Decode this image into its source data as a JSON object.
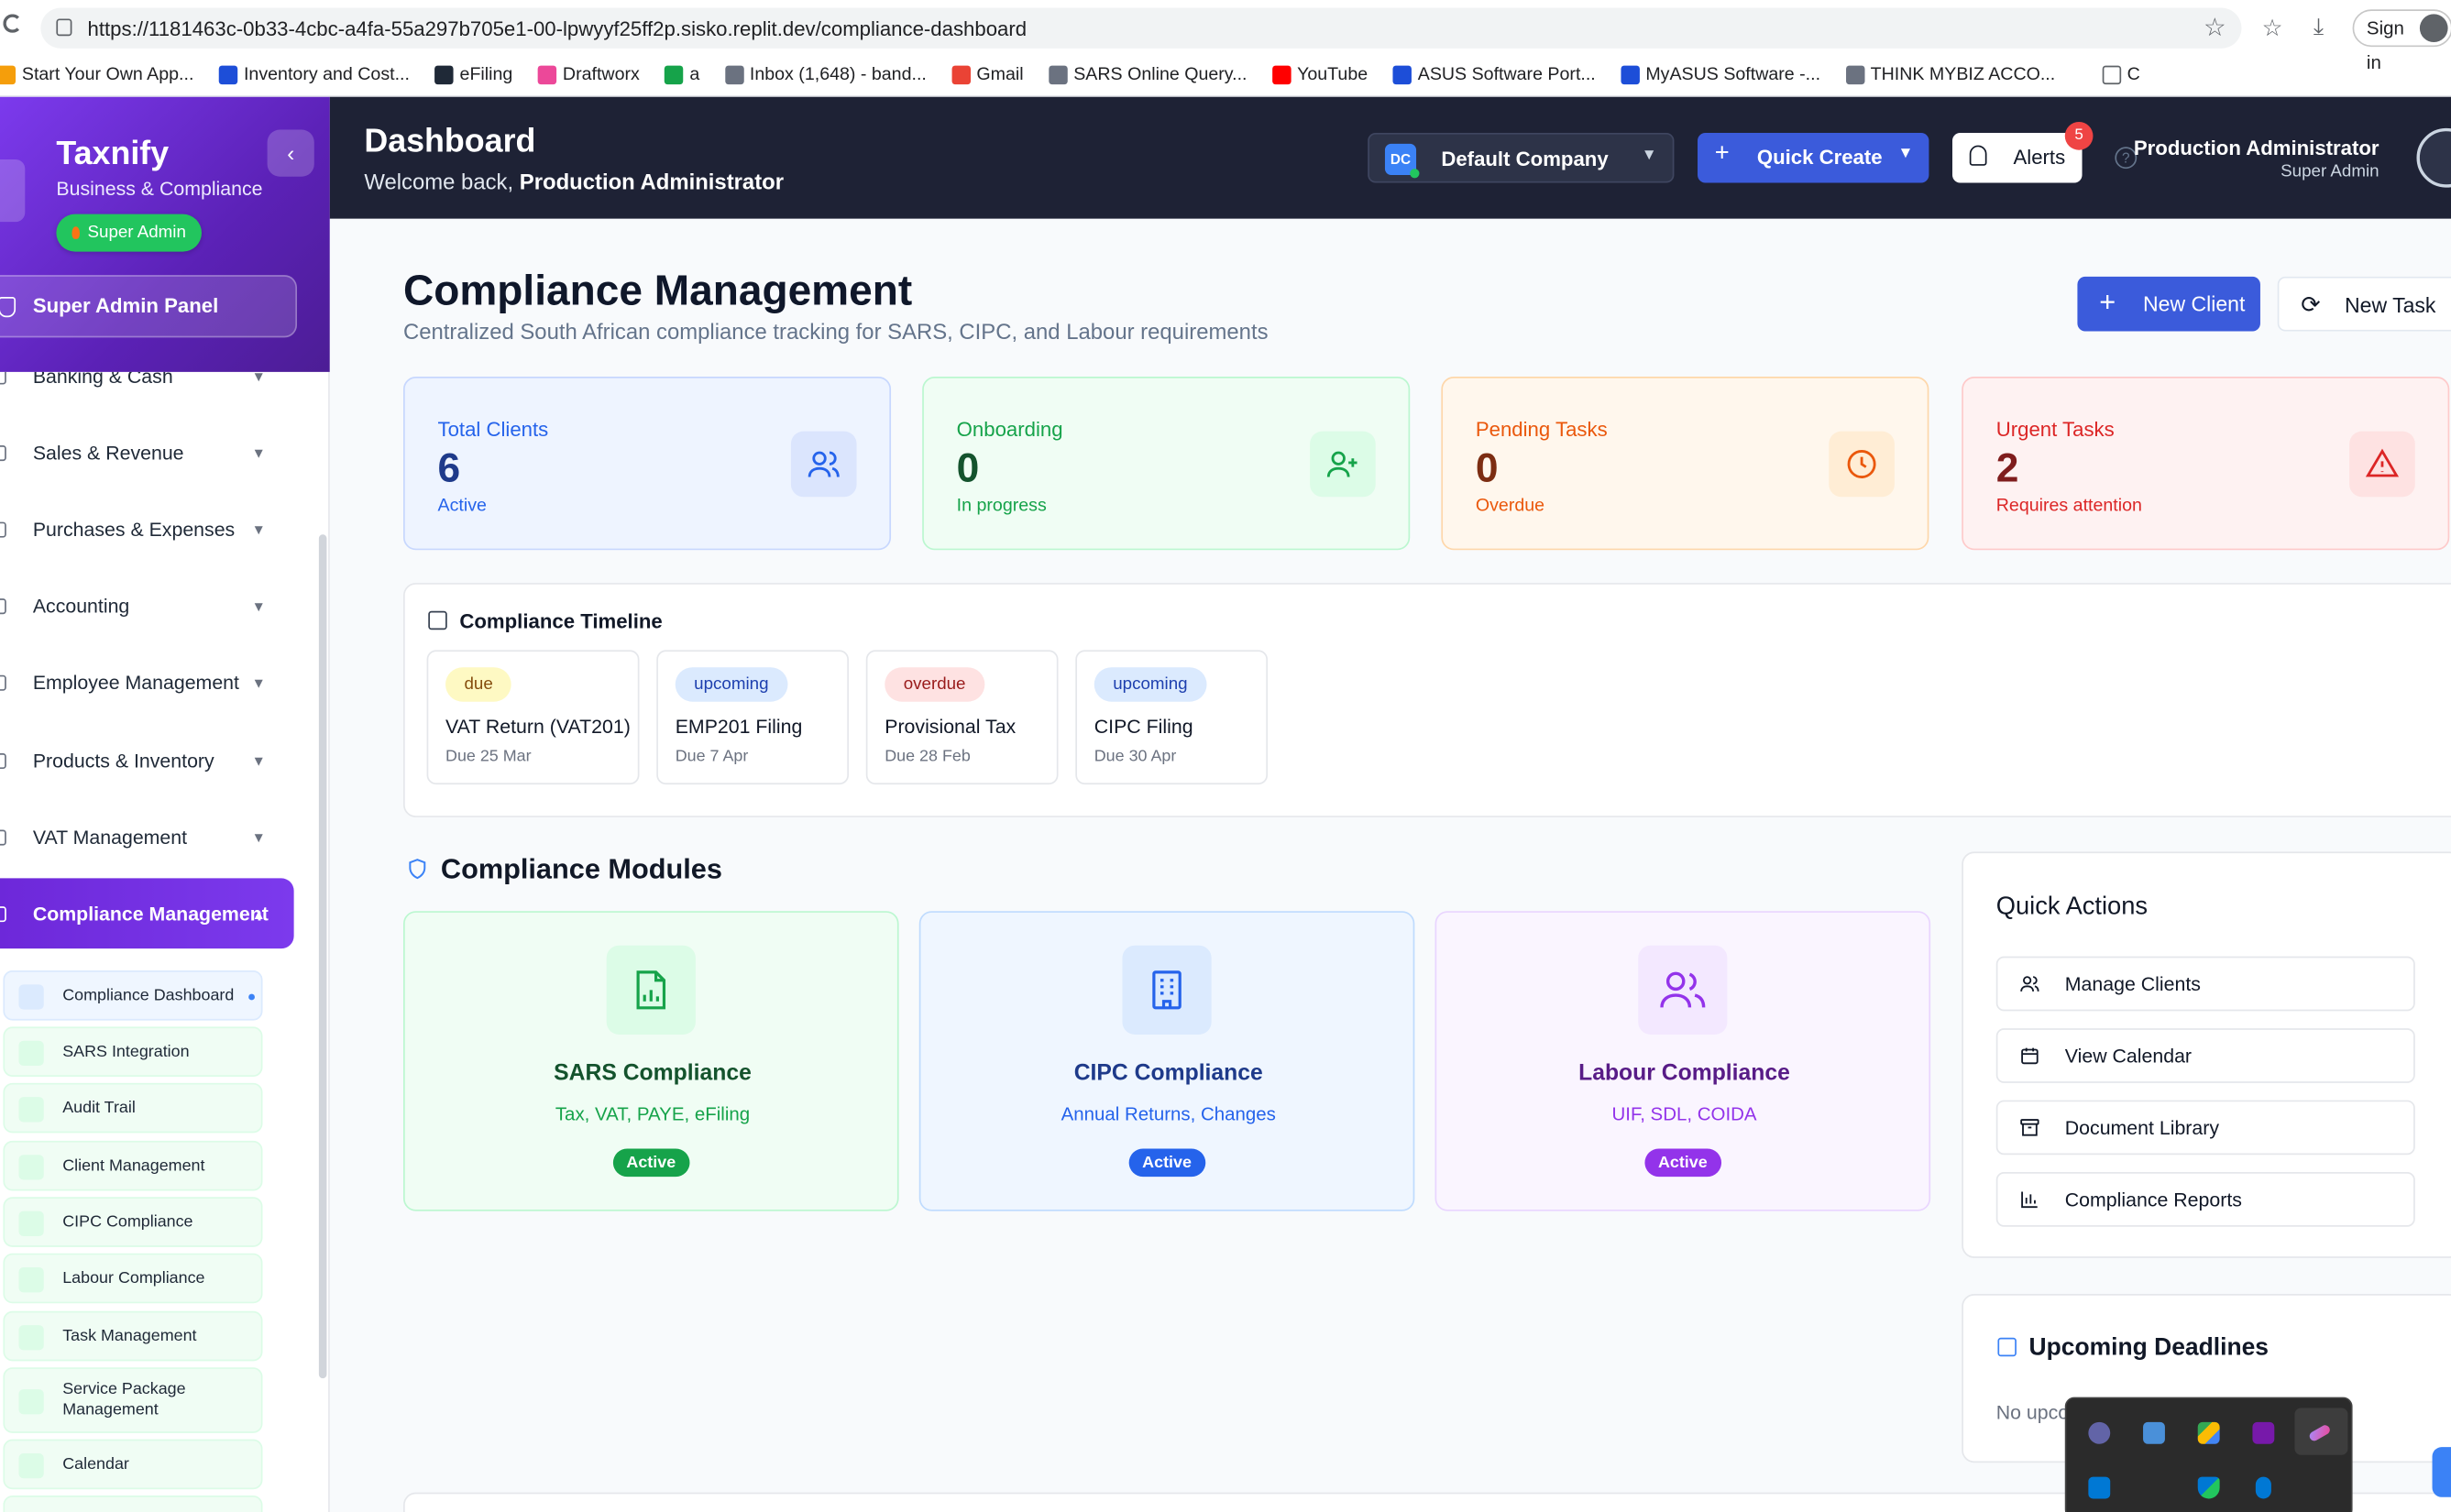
{
  "browser": {
    "url": "https://1181463c-0b33-4cbc-a4fa-55a297b705e1-00-lpwyyf25ff2p.sisko.replit.dev/compliance-dashboard",
    "signin_label": "Sign in",
    "bookmarks": [
      {
        "label": "Start Your Own App...",
        "color": "#f59e0b"
      },
      {
        "label": "Inventory and Cost...",
        "color": "#1d4ed8"
      },
      {
        "label": "eFiling",
        "color": "#1f2937"
      },
      {
        "label": "Draftworx",
        "color": "#ec4899"
      },
      {
        "label": "a",
        "color": "#16a34a"
      },
      {
        "label": "Inbox (1,648) - band...",
        "color": "#6b7280"
      },
      {
        "label": "Gmail",
        "color": "#ea4335"
      },
      {
        "label": "SARS Online Query...",
        "color": "#6b7280"
      },
      {
        "label": "YouTube",
        "color": "#ff0000"
      },
      {
        "label": "ASUS Software Port...",
        "color": "#1d4ed8"
      },
      {
        "label": "MyASUS Software -...",
        "color": "#1d4ed8"
      },
      {
        "label": "THINK MYBIZ ACCO...",
        "color": "#6b7280"
      }
    ],
    "bookmarks_overflow": "C"
  },
  "sidebar": {
    "brand": "Taxnify",
    "brand_sub": "Business & Compliance",
    "role_badge": "Super Admin",
    "collapse_icon": "chevron-left-icon",
    "super_admin_panel": "Super Admin Panel",
    "nav": [
      {
        "label": "Banking & Cash"
      },
      {
        "label": "Sales & Revenue"
      },
      {
        "label": "Purchases & Expenses"
      },
      {
        "label": "Accounting"
      },
      {
        "label": "Employee Management"
      },
      {
        "label": "Products & Inventory"
      },
      {
        "label": "VAT Management"
      },
      {
        "label": "Compliance Management"
      }
    ],
    "sub_items": [
      {
        "label": "Compliance Dashboard"
      },
      {
        "label": "SARS Integration"
      },
      {
        "label": "Audit Trail"
      },
      {
        "label": "Client Management"
      },
      {
        "label": "CIPC Compliance"
      },
      {
        "label": "Labour Compliance"
      },
      {
        "label": "Task Management"
      },
      {
        "label": "Service Package Management"
      },
      {
        "label": "Calendar"
      }
    ]
  },
  "header": {
    "title": "Dashboard",
    "welcome_prefix": "Welcome back,",
    "welcome_name": "Production Administrator",
    "company_initials": "DC",
    "company_name": "Default Company",
    "quick_create": "Quick Create",
    "alerts_label": "Alerts",
    "alerts_count": "5",
    "user_name": "Production Administrator",
    "user_role": "Super Admin"
  },
  "page": {
    "title": "Compliance Management",
    "subtitle": "Centralized South African compliance tracking for SARS, CIPC, and Labour requirements",
    "new_client": "New Client",
    "new_task": "New Task"
  },
  "stats": [
    {
      "title": "Total Clients",
      "value": "6",
      "sub": "Active",
      "icon": "users-icon"
    },
    {
      "title": "Onboarding",
      "value": "0",
      "sub": "In progress",
      "icon": "user-plus-icon"
    },
    {
      "title": "Pending Tasks",
      "value": "0",
      "sub": "Overdue",
      "icon": "clock-icon"
    },
    {
      "title": "Urgent Tasks",
      "value": "2",
      "sub": "Requires attention",
      "icon": "alert-triangle-icon"
    }
  ],
  "timeline": {
    "title": "Compliance Timeline",
    "items": [
      {
        "status": "due",
        "name": "VAT Return (VAT201)",
        "due": "Due 25 Mar"
      },
      {
        "status": "upcoming",
        "name": "EMP201 Filing",
        "due": "Due 7 Apr"
      },
      {
        "status": "overdue",
        "name": "Provisional Tax",
        "due": "Due 28 Feb"
      },
      {
        "status": "upcoming",
        "name": "CIPC Filing",
        "due": "Due 30 Apr"
      }
    ]
  },
  "modules": {
    "title": "Compliance Modules",
    "items": [
      {
        "name": "SARS Compliance",
        "desc": "Tax, VAT, PAYE, eFiling",
        "status": "Active",
        "icon": "file-chart-icon"
      },
      {
        "name": "CIPC Compliance",
        "desc": "Annual Returns, Changes",
        "status": "Active",
        "icon": "building-icon"
      },
      {
        "name": "Labour Compliance",
        "desc": "UIF, SDL, COIDA",
        "status": "Active",
        "icon": "users-icon"
      }
    ]
  },
  "quick_actions": {
    "title": "Quick Actions",
    "items": [
      {
        "label": "Manage Clients",
        "icon": "users-icon"
      },
      {
        "label": "View Calendar",
        "icon": "calendar-icon"
      },
      {
        "label": "Document Library",
        "icon": "archive-icon"
      },
      {
        "label": "Compliance Reports",
        "icon": "bar-chart-icon"
      }
    ]
  },
  "deadlines": {
    "title": "Upcoming Deadlines",
    "empty_text": "No upco"
  }
}
